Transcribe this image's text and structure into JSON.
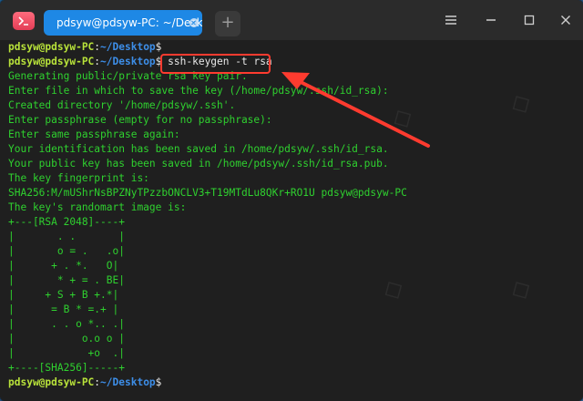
{
  "window": {
    "tab_title": "pdsyw@pdsyw-PC: ~/Desktop",
    "new_tab_symbol": "+"
  },
  "colors": {
    "accent": "#1e88e5",
    "terminal_bg": "#1f1f1f",
    "output_green": "#2fd12f",
    "prompt_user": "#b8e23a",
    "prompt_path": "#3d8ee8",
    "annotation_red": "#ff3b2f"
  },
  "terminal": {
    "prompt_user": "pdsyw@pdsyw-PC",
    "prompt_sep": ":",
    "prompt_path": "~/Desktop",
    "prompt_sign": "$",
    "command": " ssh-keygen -t rsa",
    "output": [
      "Generating public/private rsa key pair.",
      "Enter file in which to save the key (/home/pdsyw/.ssh/id_rsa):",
      "Created directory '/home/pdsyw/.ssh'.",
      "Enter passphrase (empty for no passphrase):",
      "Enter same passphrase again:",
      "Your identification has been saved in /home/pdsyw/.ssh/id_rsa.",
      "Your public key has been saved in /home/pdsyw/.ssh/id_rsa.pub.",
      "The key fingerprint is:",
      "SHA256:M/mUShrNsBPZNyTPzzbONCLV3+T19MTdLu8QKr+RO1U pdsyw@pdsyw-PC",
      "The key's randomart image is:",
      "+---[RSA 2048]----+",
      "|       . .       |",
      "|       o = .   .o|",
      "|      + . *.   O|",
      "|       * + = . BE|",
      "|     + S + B +.*|",
      "|      = B * =.+ |",
      "|      . . o *.. .|",
      "|           o.o o |",
      "|            +o  .|",
      "+----[SHA256]-----+"
    ]
  },
  "icons": {
    "app": "terminal-app-icon",
    "tab_close": "close-icon",
    "menu": "menu-icon",
    "minimize": "minimize-icon",
    "maximize": "maximize-icon",
    "close": "close-icon"
  }
}
